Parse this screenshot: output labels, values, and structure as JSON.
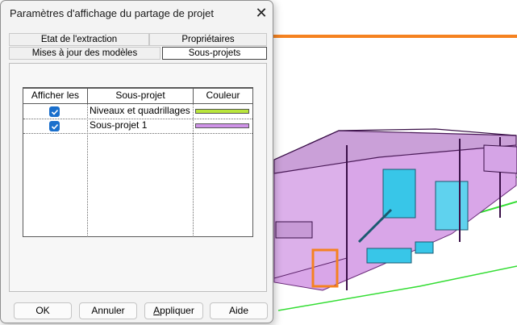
{
  "dialog": {
    "title": "Paramètres d'affichage du partage de projet",
    "close_glyph": "✕"
  },
  "tabs": [
    {
      "label": "Etat de l'extraction",
      "active": false
    },
    {
      "label": "Propriétaires",
      "active": false
    },
    {
      "label": "Mises à jour des modèles",
      "active": false
    },
    {
      "label": "Sous-projets",
      "active": true
    }
  ],
  "table": {
    "headers": [
      "Afficher les",
      "Sous-projet",
      "Couleur"
    ],
    "rows": [
      {
        "checked": true,
        "name": "Niveaux et quadrillages",
        "color": "#b9e63c"
      },
      {
        "checked": true,
        "name": "Sous-projet 1",
        "color": "#cf93e8"
      }
    ]
  },
  "buttons": {
    "ok": "OK",
    "cancel": "Annuler",
    "apply_mnemonic": "A",
    "apply_rest": "ppliquer",
    "help": "Aide"
  },
  "colors": {
    "accent": "#1a6fcc",
    "orange_line": "#f58220",
    "model_purple": "#d9a6e8",
    "model_cyan": "#38c6e8",
    "model_green": "#33dd33"
  },
  "viewport": {
    "content": "3D model view of a building colored by worksets"
  }
}
